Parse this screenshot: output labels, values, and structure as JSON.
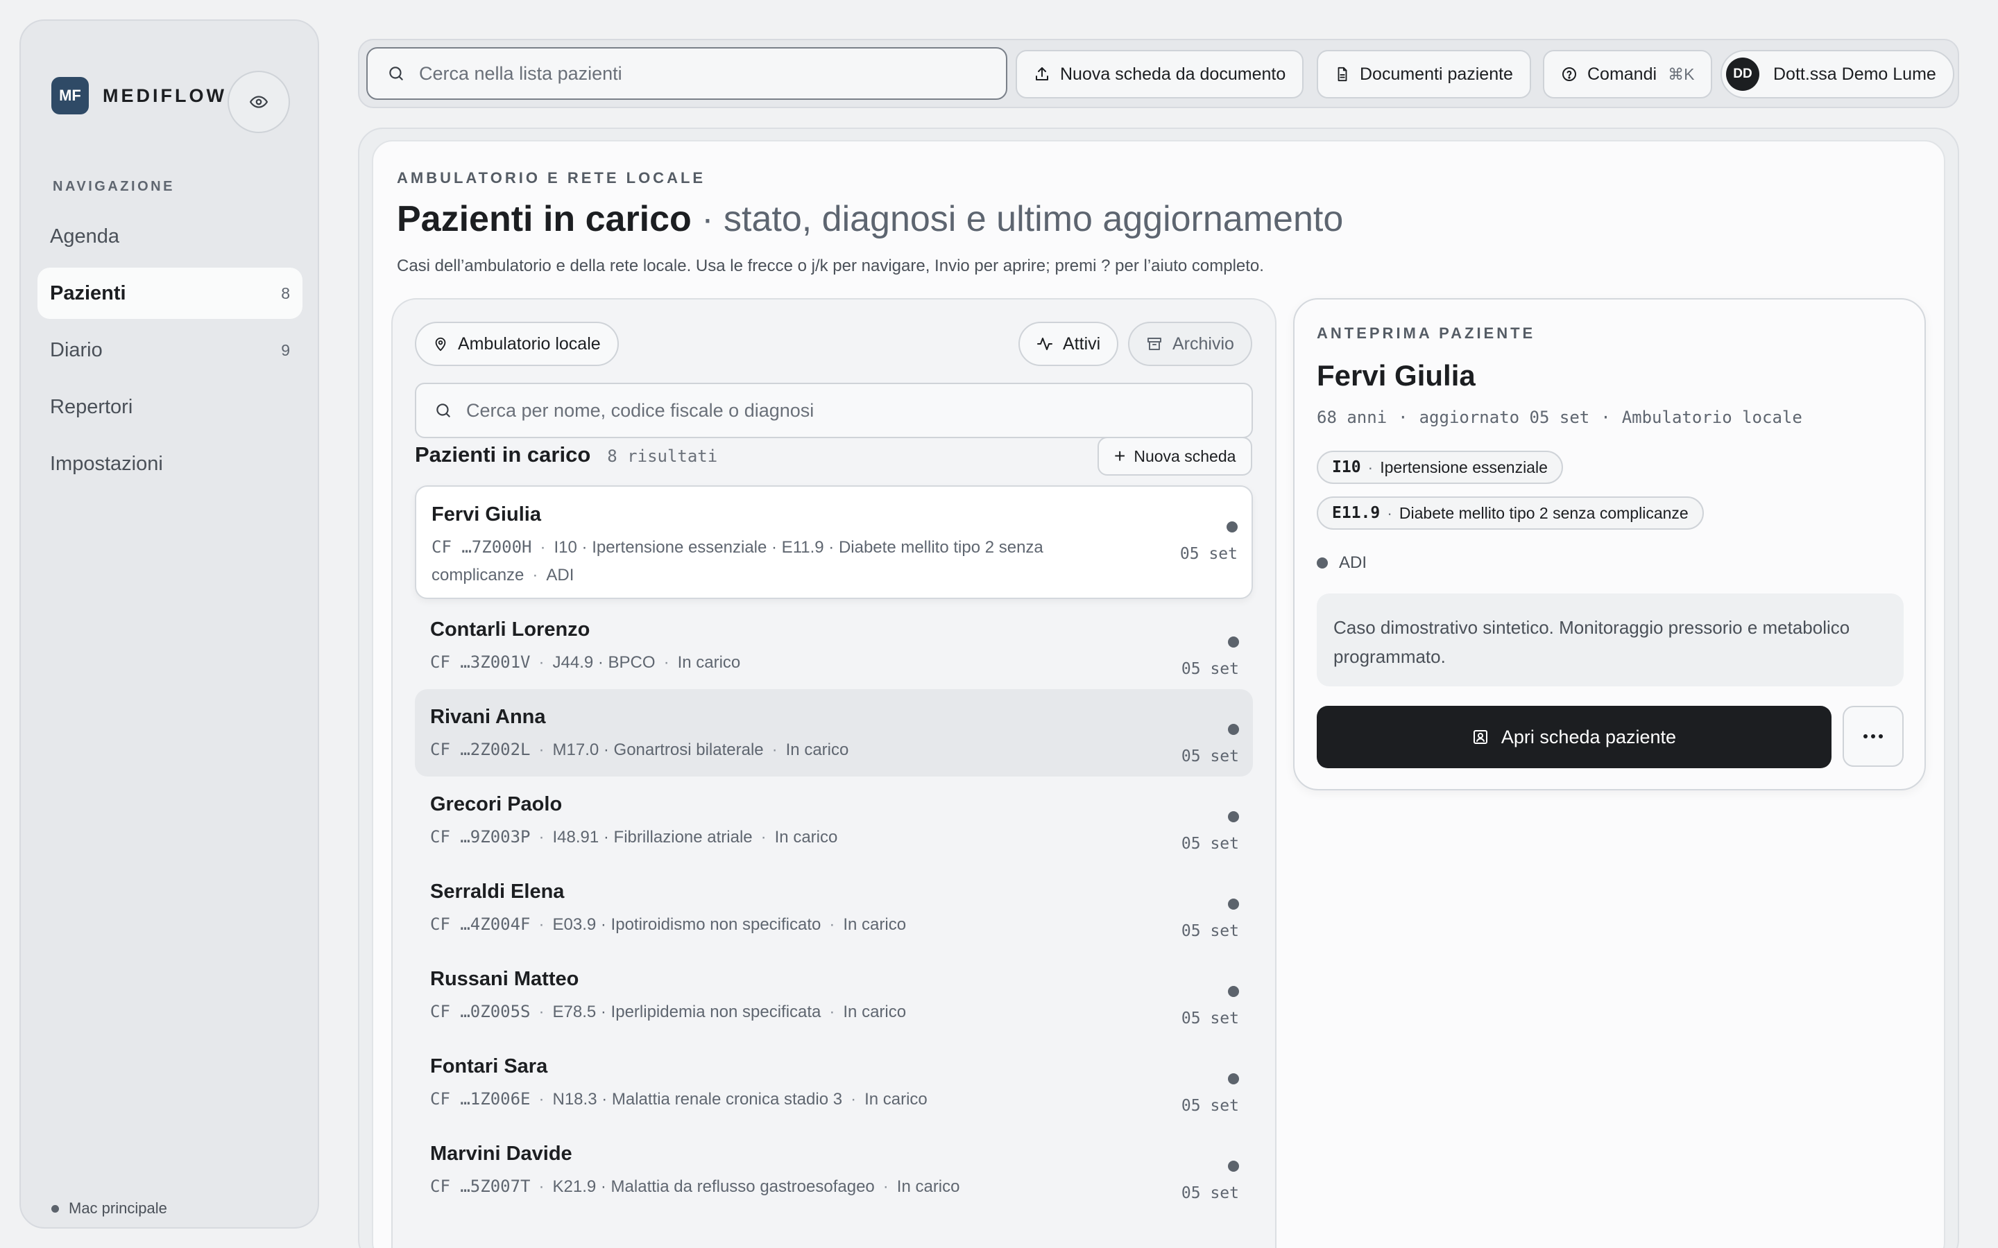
{
  "app": {
    "logo_text": "MF",
    "name": "MEDIFLOW"
  },
  "sidebar": {
    "heading": "NAVIGAZIONE",
    "items": [
      {
        "label": "Agenda",
        "count": ""
      },
      {
        "label": "Pazienti",
        "count": "8"
      },
      {
        "label": "Diario",
        "count": "9"
      },
      {
        "label": "Repertori",
        "count": ""
      },
      {
        "label": "Impostazioni",
        "count": ""
      }
    ],
    "footer": "Mac principale"
  },
  "topbar": {
    "search_placeholder": "Cerca nella lista pazienti",
    "new_from_doc": "Nuova scheda da documento",
    "patient_docs": "Documenti paziente",
    "commands": "Comandi",
    "commands_shortcut": "⌘K",
    "user_initials": "DD",
    "user_name": "Dott.ssa Demo Lume"
  },
  "page": {
    "eyebrow": "AMBULATORIO E RETE LOCALE",
    "title": "Pazienti in carico",
    "subtitle": " · stato, diagnosi e ultimo aggiornamento",
    "description": "Casi dell’ambulatorio e della rete locale. Usa le frecce o j/k per navigare, Invio per aprire; premi ? per l’aiuto completo."
  },
  "list": {
    "filter_location": "Ambulatorio locale",
    "filter_active": "Attivi",
    "filter_archive": "Archivio",
    "search_placeholder": "Cerca per nome, codice fiscale o diagnosi",
    "title": "Pazienti in carico",
    "count": "8 risultati",
    "new_button": "Nuova scheda",
    "rows": [
      {
        "name": "Fervi Giulia",
        "cf": "CF …7Z000H",
        "diagnosis": "I10 · Ipertensione essenziale · E11.9 · Diabete mellito tipo 2 senza complicanze",
        "status": "ADI",
        "date": "05 set"
      },
      {
        "name": "Contarli Lorenzo",
        "cf": "CF …3Z001V",
        "diagnosis": "J44.9 · BPCO",
        "status": "In carico",
        "date": "05 set"
      },
      {
        "name": "Rivani Anna",
        "cf": "CF …2Z002L",
        "diagnosis": "M17.0 · Gonartrosi bilaterale",
        "status": "In carico",
        "date": "05 set"
      },
      {
        "name": "Grecori Paolo",
        "cf": "CF …9Z003P",
        "diagnosis": "I48.91 · Fibrillazione atriale",
        "status": "In carico",
        "date": "05 set"
      },
      {
        "name": "Serraldi Elena",
        "cf": "CF …4Z004F",
        "diagnosis": "E03.9 · Ipotiroidismo non specificato",
        "status": "In carico",
        "date": "05 set"
      },
      {
        "name": "Russani Matteo",
        "cf": "CF …0Z005S",
        "diagnosis": "E78.5 · Iperlipidemia non specificata",
        "status": "In carico",
        "date": "05 set"
      },
      {
        "name": "Fontari Sara",
        "cf": "CF …1Z006E",
        "diagnosis": "N18.3 · Malattia renale cronica stadio 3",
        "status": "In carico",
        "date": "05 set"
      },
      {
        "name": "Marvini Davide",
        "cf": "CF …5Z007T",
        "diagnosis": "K21.9 · Malattia da reflusso gastroesofageo",
        "status": "In carico",
        "date": "05 set"
      }
    ]
  },
  "preview": {
    "eyebrow": "ANTEPRIMA PAZIENTE",
    "name": "Fervi Giulia",
    "age": "68 anni",
    "updated": "aggiornato 05 set",
    "location": "Ambulatorio locale",
    "tags": [
      {
        "code": "I10",
        "label": "Ipertensione essenziale"
      },
      {
        "code": "E11.9",
        "label": "Diabete mellito tipo 2 senza complicanze"
      }
    ],
    "status": "ADI",
    "note": "Caso dimostrativo sintetico. Monitoraggio pressorio e metabolico programmato.",
    "open_button": "Apri scheda paziente"
  },
  "icons": [
    "eye-icon",
    "search-icon",
    "upload-icon",
    "document-icon",
    "help-circle-icon",
    "map-pin-icon",
    "activity-icon",
    "archive-icon",
    "plus-icon",
    "contact-card-icon",
    "more-horizontal-icon"
  ]
}
